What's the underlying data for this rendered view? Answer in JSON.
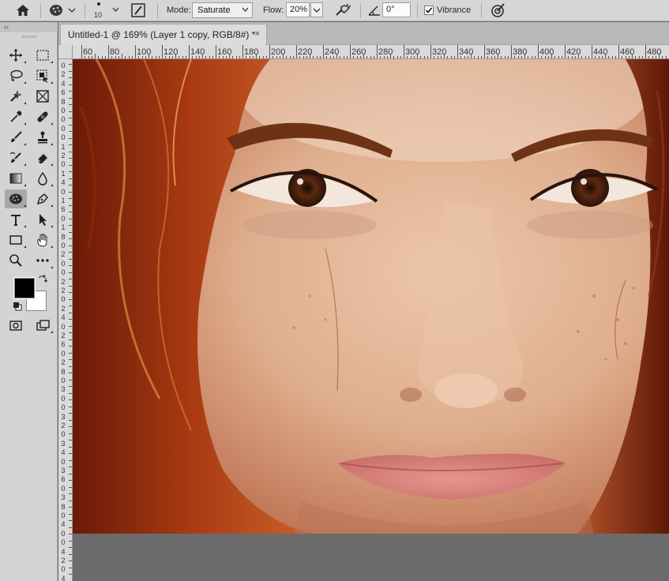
{
  "options_bar": {
    "brush_size": "10",
    "mode_label": "Mode:",
    "mode_value": "Saturate",
    "flow_label": "Flow:",
    "flow_value": "20%",
    "angle_value": "0°",
    "vibrance_label": "Vibrance",
    "vibrance_checked": true
  },
  "document_tab": {
    "title": "Untitled-1 @ 169% (Layer 1 copy, RGB/8#) *",
    "close": "×"
  },
  "toolbar": {
    "collapse": "‹‹",
    "tools": [
      {
        "name": "move-tool-icon"
      },
      {
        "name": "marquee-tool-icon"
      },
      {
        "name": "lasso-tool-icon"
      },
      {
        "name": "object-select-tool-icon"
      },
      {
        "name": "quick-select-tool-icon"
      },
      {
        "name": "frame-tool-icon"
      },
      {
        "name": "eyedropper-tool-icon"
      },
      {
        "name": "healing-tool-icon"
      },
      {
        "name": "brush-tool-icon"
      },
      {
        "name": "stamp-tool-icon"
      },
      {
        "name": "history-brush-tool-icon"
      },
      {
        "name": "eraser-tool-icon"
      },
      {
        "name": "gradient-tool-icon"
      },
      {
        "name": "blur-tool-icon"
      },
      {
        "name": "sponge-tool-icon",
        "active": true
      },
      {
        "name": "pen-tool-icon"
      },
      {
        "name": "type-tool-icon"
      },
      {
        "name": "path-select-tool-icon"
      },
      {
        "name": "rectangle-tool-icon"
      },
      {
        "name": "hand-tool-icon"
      },
      {
        "name": "zoom-tool-icon"
      },
      {
        "name": "more-tools-icon"
      }
    ],
    "foreground_color": "#000000",
    "background_color": "#ffffff"
  },
  "ruler": {
    "horizontal_labels": [
      "60",
      "80",
      "100",
      "120",
      "140",
      "160",
      "180",
      "200",
      "220",
      "240",
      "260",
      "280",
      "300",
      "320",
      "340",
      "360",
      "380",
      "400",
      "420",
      "440",
      "460",
      "480"
    ],
    "vertical_labels": [
      "0",
      "2",
      "4",
      "6",
      "8",
      "0",
      "0",
      "0",
      "0",
      "1",
      "2",
      "0",
      "1",
      "4",
      "0",
      "1",
      "6",
      "0",
      "1",
      "8",
      "0",
      "2",
      "0",
      "0",
      "2",
      "2",
      "0",
      "2",
      "4",
      "0",
      "2",
      "6",
      "0",
      "2",
      "8",
      "0",
      "3",
      "0",
      "0",
      "3",
      "2",
      "0",
      "3",
      "4",
      "0",
      "3",
      "6",
      "0",
      "3",
      "8",
      "0",
      "4",
      "0",
      "0",
      "4",
      "2",
      "0",
      "4"
    ]
  },
  "colors": {
    "ui_panel": "#d6d6d6",
    "pasteboard": "#6b6b6b"
  }
}
